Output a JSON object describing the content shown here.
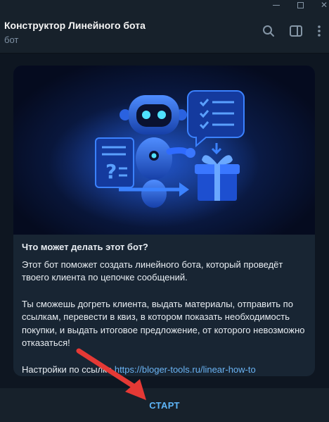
{
  "header": {
    "title": "Конструктор Линейного бота",
    "subtitle": "бот"
  },
  "icons": {
    "search": "search-icon",
    "panel": "sidebar-panel-icon",
    "more": "more-vertical-icon",
    "minimize": "minimize-icon",
    "maximize": "maximize-icon",
    "close": "close-icon"
  },
  "card": {
    "heading": "Что может делать этот бот?",
    "para1": "Этот бот поможет создать линейного бота, который проведёт твоего клиента по цепочке сообщений.",
    "para2": "Ты сможешь догреть клиента, выдать материалы, отправить по ссылкам, перевести в квиз, в котором показать необходимость покупки, и выдать итоговое предложение, от которого невозможно отказаться!",
    "settings_prefix": "Настройки по ссылке ",
    "settings_link": "https://bloger-tools.ru/linear-how-to"
  },
  "bottom": {
    "start_label": "СТАРТ"
  },
  "colors": {
    "background": "#0e1621",
    "header": "#17212b",
    "bubble": "#182533",
    "accent": "#5eb5f7",
    "link": "#6ab3f3",
    "arrow": "#e53935"
  }
}
